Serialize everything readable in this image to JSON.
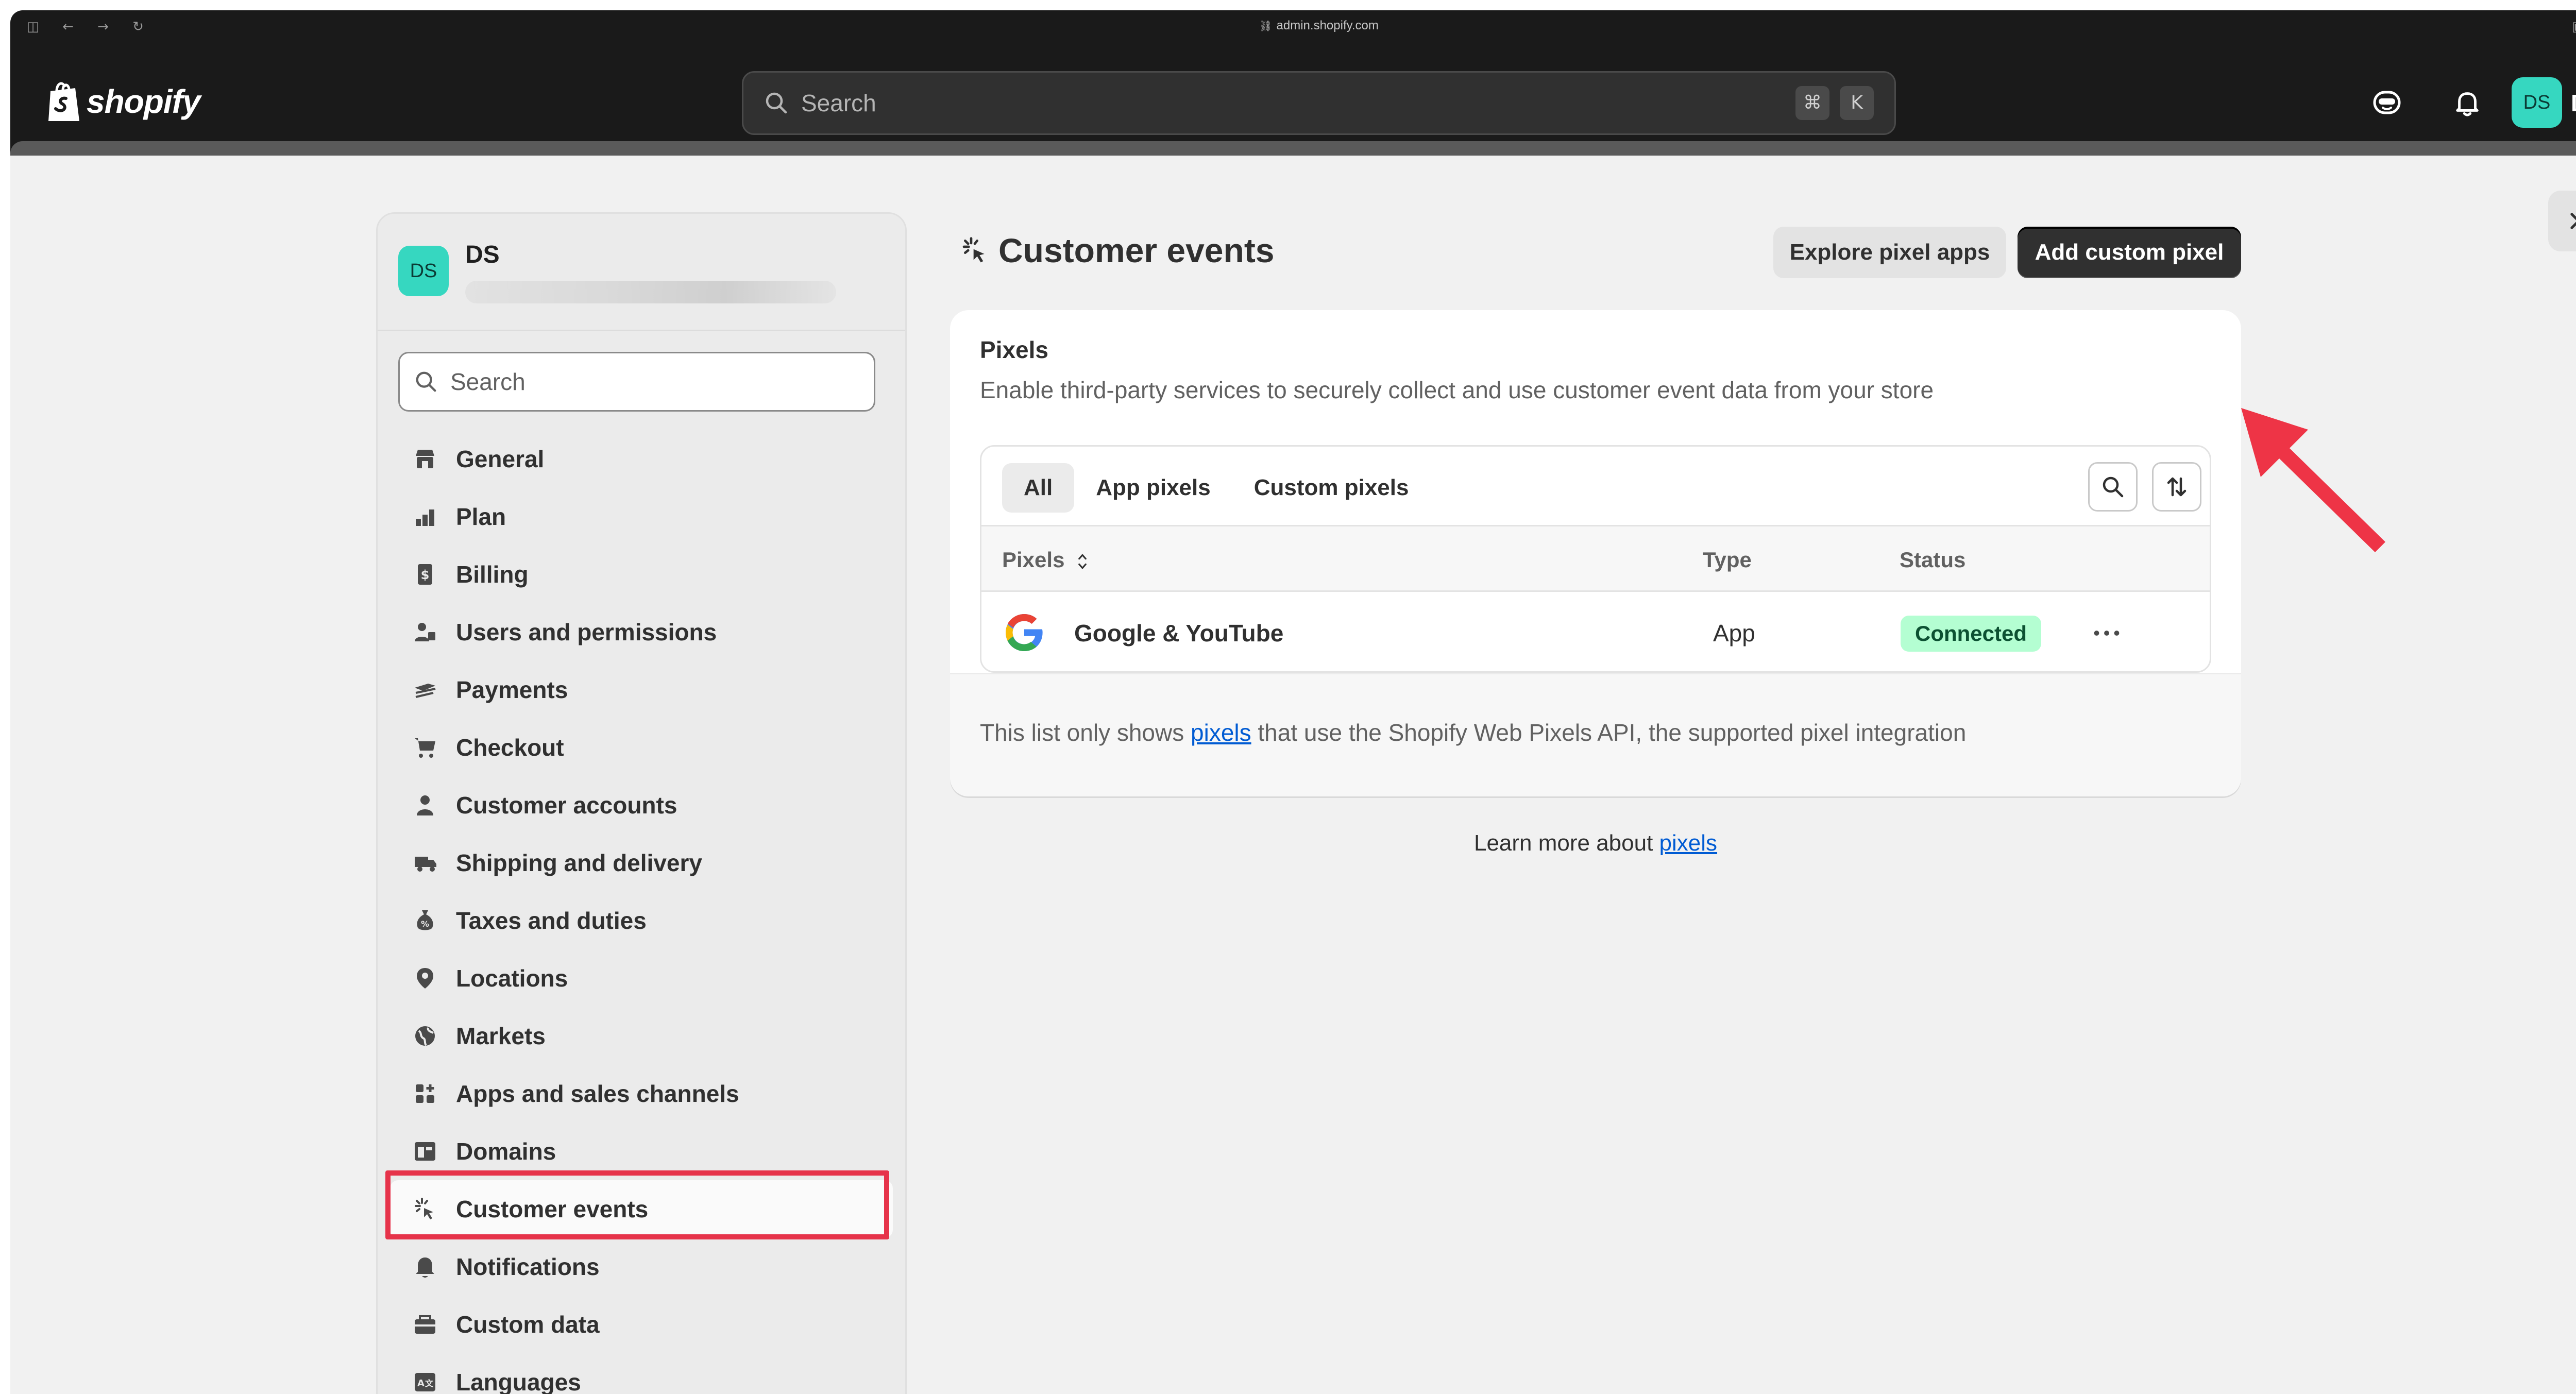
{
  "browser": {
    "url": "admin.shopify.com"
  },
  "topbar": {
    "brand": "shopify",
    "search_placeholder": "Search",
    "shortcut_cmd": "⌘",
    "shortcut_key": "K",
    "avatar_initials": "DS",
    "user_name": "DS"
  },
  "sidebar": {
    "store_initials": "DS",
    "store_name": "DS",
    "search_placeholder": "Search",
    "items": [
      {
        "label": "General",
        "icon": "store-icon"
      },
      {
        "label": "Plan",
        "icon": "plan-icon"
      },
      {
        "label": "Billing",
        "icon": "billing-icon"
      },
      {
        "label": "Users and permissions",
        "icon": "users-icon"
      },
      {
        "label": "Payments",
        "icon": "payments-icon"
      },
      {
        "label": "Checkout",
        "icon": "cart-icon"
      },
      {
        "label": "Customer accounts",
        "icon": "person-icon"
      },
      {
        "label": "Shipping and delivery",
        "icon": "truck-icon"
      },
      {
        "label": "Taxes and duties",
        "icon": "tax-icon"
      },
      {
        "label": "Locations",
        "icon": "location-pin-icon"
      },
      {
        "label": "Markets",
        "icon": "globe-icon"
      },
      {
        "label": "Apps and sales channels",
        "icon": "apps-icon"
      },
      {
        "label": "Domains",
        "icon": "domains-icon"
      },
      {
        "label": "Customer events",
        "icon": "customer-events-icon",
        "active": true
      },
      {
        "label": "Notifications",
        "icon": "bell-icon"
      },
      {
        "label": "Custom data",
        "icon": "custom-data-icon"
      },
      {
        "label": "Languages",
        "icon": "languages-icon"
      }
    ]
  },
  "main": {
    "title": "Customer events",
    "explore_button": "Explore pixel apps",
    "add_button": "Add custom pixel",
    "card": {
      "heading": "Pixels",
      "description": "Enable third-party services to securely collect and use customer event data from your store",
      "tabs": [
        "All",
        "App pixels",
        "Custom pixels"
      ],
      "columns": {
        "pixels": "Pixels",
        "type": "Type",
        "status": "Status"
      },
      "rows": [
        {
          "name": "Google & YouTube",
          "type": "App",
          "status": "Connected"
        }
      ],
      "footer_before": "This list only shows ",
      "footer_link": "pixels",
      "footer_after": " that use the Shopify Web Pixels API, the supported pixel integration"
    },
    "learn_before": "Learn more about ",
    "learn_link": "pixels"
  },
  "colors": {
    "accent_dark": "#303030",
    "status_connected_bg": "#b4fed2",
    "annotation_red": "#e6334a",
    "avatar_teal": "#36d7c0",
    "link_blue": "#005bd3"
  }
}
